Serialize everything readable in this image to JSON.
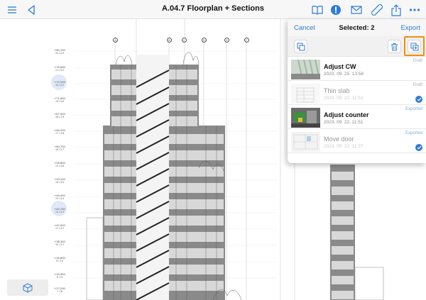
{
  "toolbar": {
    "title": "A.04.7 Floorplan + Sections",
    "icons": {
      "left": [
        "list-icon",
        "back-triangle-icon"
      ],
      "right": [
        "book-icon",
        "notification-badge-icon",
        "mail-icon",
        "ruler-icon",
        "share-icon",
        "more-icon"
      ]
    }
  },
  "levels": [
    {
      "value": "+80,700",
      "sub": "22 L23"
    },
    {
      "value": "+76,600",
      "sub": "21 L22"
    },
    {
      "value": "+72,500",
      "sub": "20 L21"
    },
    {
      "value": "+71,800",
      "sub": "19 L20"
    },
    {
      "value": "+67,900",
      "sub": "18 L19"
    },
    {
      "value": "+64,200",
      "sub": "17 L18"
    },
    {
      "value": "+60,700",
      "sub": "16 L17"
    },
    {
      "value": "+56,800",
      "sub": "15 L16"
    },
    {
      "value": "+53,100",
      "sub": "14 L15"
    },
    {
      "value": "+49,400",
      "sub": "13 L14"
    },
    {
      "value": "+45,700",
      "sub": "12 L13"
    },
    {
      "value": "+42,000",
      "sub": "11 L12"
    },
    {
      "value": "+38,300",
      "sub": "10 L11"
    },
    {
      "value": "+34,600",
      "sub": "9 L10"
    },
    {
      "value": "+30,900",
      "sub": "8 L9"
    },
    {
      "value": "+27,200",
      "sub": "7 L8"
    }
  ],
  "grid_bubbles": [
    "A",
    "B",
    "C",
    "D",
    "E",
    "F"
  ],
  "panel": {
    "cancel_label": "Cancel",
    "title": "Selected: 2",
    "export_label": "Export",
    "tools": [
      "layers-icon",
      "trash-icon",
      "duplicate-add-icon"
    ],
    "items": [
      {
        "name": "Adjust CW",
        "date": "2023. 09. 25. 13:58",
        "status": "Draft",
        "selected": false
      },
      {
        "name": "Thin slab",
        "date": "2023. 09. 22. 11:53",
        "status": "Draft",
        "selected": true
      },
      {
        "name": "Adjust counter",
        "date": "2023. 09. 22. 11:51",
        "status": "Exported",
        "selected": false
      },
      {
        "name": "Move door",
        "date": "2023. 09. 22. 11:37",
        "status": "Exported",
        "selected": true
      }
    ]
  },
  "colors": {
    "accent": "#2f7bd6",
    "highlight": "#f0900c"
  }
}
